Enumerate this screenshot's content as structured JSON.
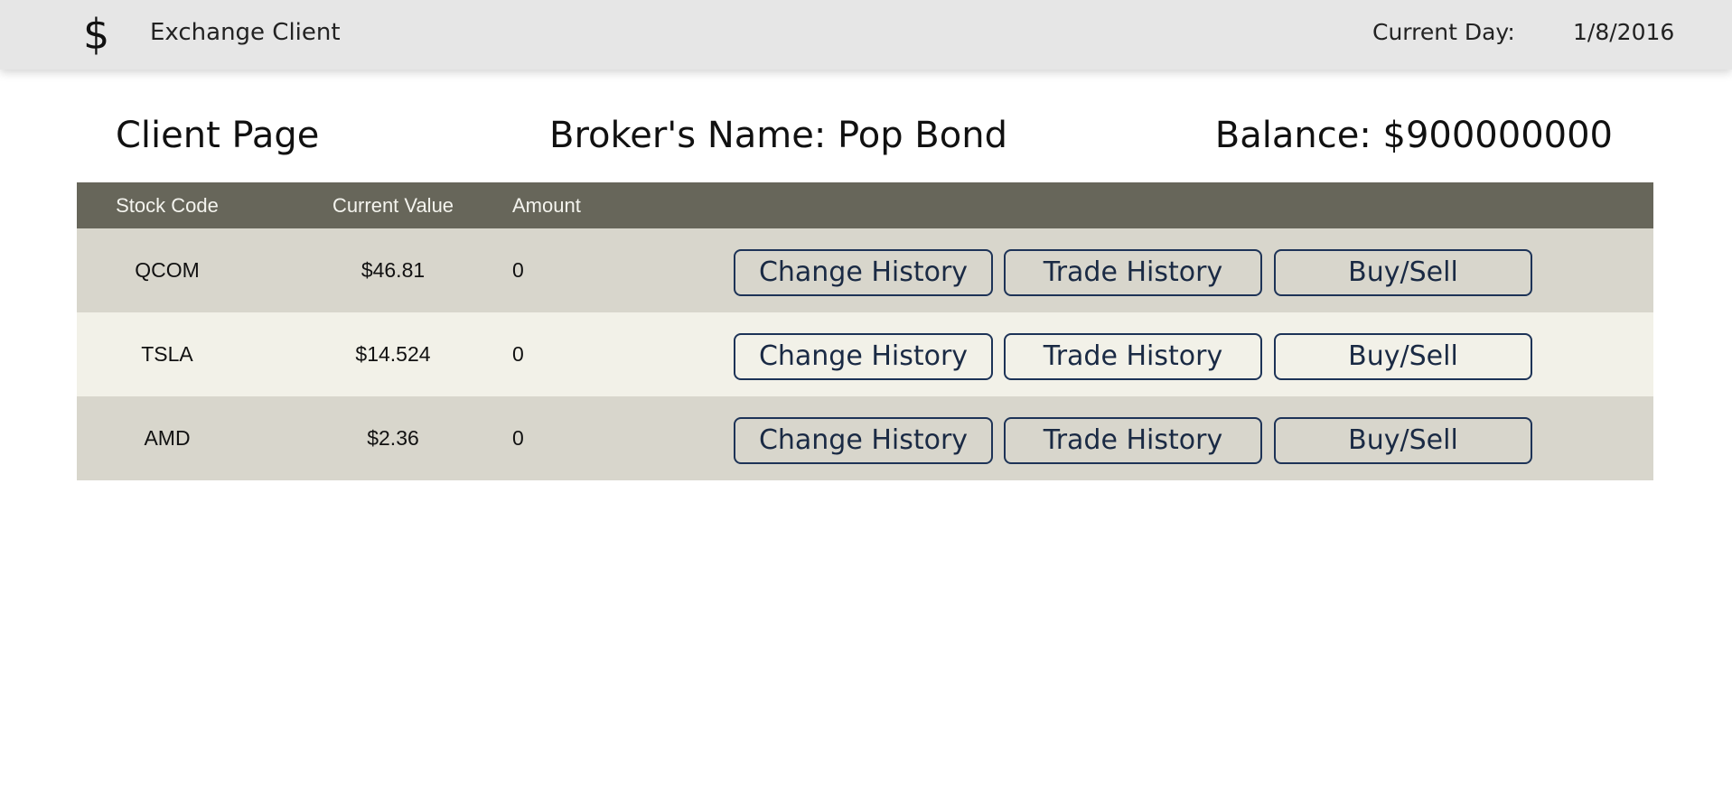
{
  "header": {
    "logo_icon": "dollar-icon",
    "logo_glyph": "$",
    "app_title": "Exchange Client",
    "current_day_label": "Current Day:",
    "current_day_value": "1/8/2016"
  },
  "page": {
    "title": "Client Page",
    "broker": "Broker's Name: Pop Bond",
    "balance": "Balance: $900000000"
  },
  "table": {
    "columns": [
      "Stock Code",
      "Current Value",
      "Amount"
    ],
    "rows": [
      {
        "code": "QCOM",
        "value": "$46.81",
        "amount": "0"
      },
      {
        "code": "TSLA",
        "value": "$14.524",
        "amount": "0"
      },
      {
        "code": "AMD",
        "value": "$2.36",
        "amount": "0"
      }
    ],
    "actions": {
      "change_history": "Change History",
      "trade_history": "Trade History",
      "buy_sell": "Buy/Sell"
    }
  },
  "colors": {
    "header_bar": "#e6e6e6",
    "table_header": "#67665a",
    "row_odd": "#d8d6cc",
    "row_even": "#f2f1e8",
    "button_border": "#1d3357"
  }
}
